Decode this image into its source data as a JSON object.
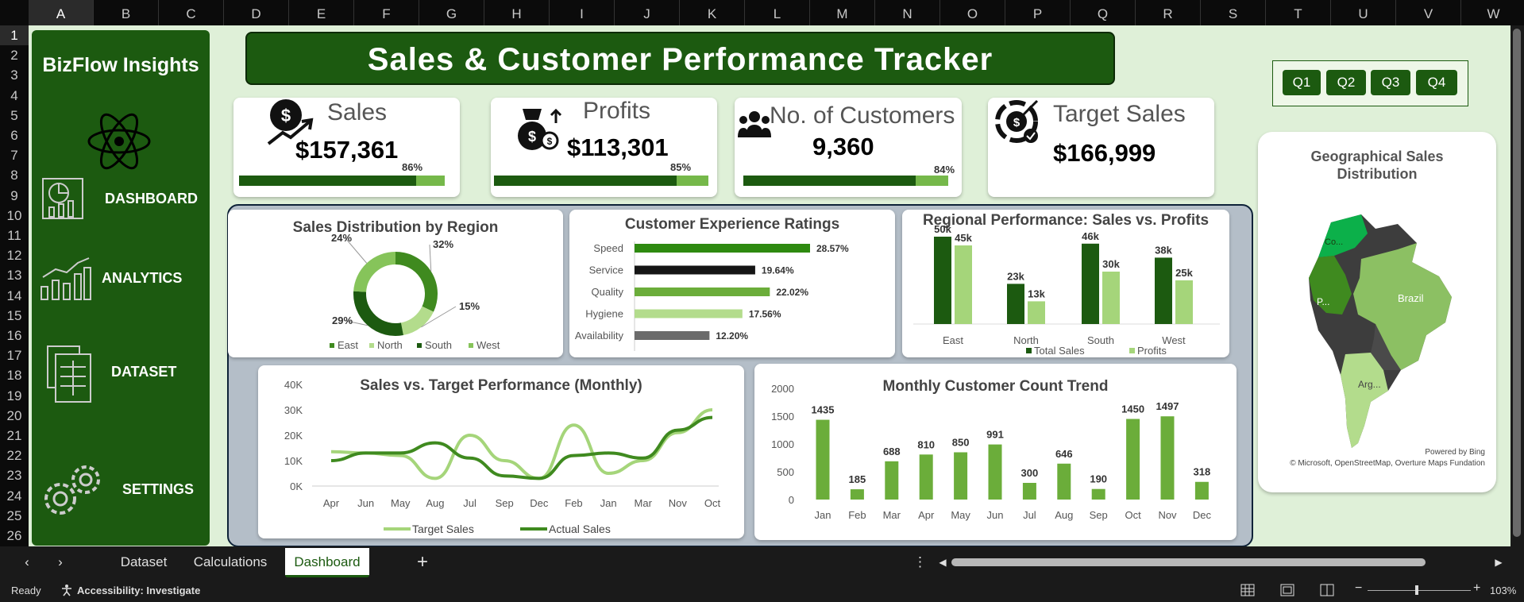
{
  "columns": [
    "A",
    "B",
    "C",
    "D",
    "E",
    "F",
    "G",
    "H",
    "I",
    "J",
    "K",
    "L",
    "M",
    "N",
    "O",
    "P",
    "Q",
    "R",
    "S",
    "T",
    "U",
    "V",
    "W"
  ],
  "rows": [
    "1",
    "2",
    "3",
    "4",
    "5",
    "6",
    "7",
    "8",
    "9",
    "10",
    "11",
    "12",
    "13",
    "14",
    "15",
    "16",
    "17",
    "18",
    "19",
    "20",
    "21",
    "22",
    "23",
    "24",
    "25",
    "26"
  ],
  "sidebar": {
    "brand": "BizFlow Insights",
    "items": [
      {
        "label": "DASHBOARD",
        "icon": "dashboard-chart-icon"
      },
      {
        "label": "ANALYTICS",
        "icon": "analytics-bars-icon"
      },
      {
        "label": "DATASET",
        "icon": "dataset-sheets-icon"
      },
      {
        "label": "SETTINGS",
        "icon": "settings-gears-icon"
      }
    ]
  },
  "title": "Sales & Customer Performance Tracker",
  "kpis": [
    {
      "label": "Sales",
      "value": "$157,361",
      "pct_label": "86%",
      "progress": 0.86,
      "icon": "dollar-growth-icon"
    },
    {
      "label": "Profits",
      "value": "$113,301",
      "pct_label": "85%",
      "progress": 0.85,
      "icon": "money-bag-icon"
    },
    {
      "label": "No. of Customers",
      "value": "9,360",
      "pct_label": "84%",
      "progress": 0.84,
      "icon": "customers-icon"
    },
    {
      "label": "Target Sales",
      "value": "$166,999",
      "icon": "target-dollar-icon"
    }
  ],
  "quarters": [
    "Q1",
    "Q2",
    "Q3",
    "Q4"
  ],
  "map": {
    "title": "Geographical Sales Distribution",
    "labels": [
      "Co...",
      "Brazil",
      "P...",
      "Arg..."
    ],
    "powered": "Powered by Bing",
    "credits": "© Microsoft, OpenStreetMap, Overture Maps Fundation"
  },
  "charts": {
    "donut": {
      "title": "Sales Distribution by Region"
    },
    "ratings": {
      "title": "Customer Experience Ratings"
    },
    "regional": {
      "title": "Regional Performance: Sales vs. Profits"
    },
    "target": {
      "title": "Sales vs. Target Performance (Monthly)"
    },
    "customers": {
      "title": "Monthly Customer Count Trend"
    }
  },
  "chart_data": [
    {
      "type": "pie",
      "title": "Sales Distribution by Region",
      "categories": [
        "East",
        "North",
        "South",
        "West"
      ],
      "values": [
        32,
        15,
        29,
        24
      ],
      "labels": [
        "32%",
        "15%",
        "29%",
        "24%"
      ],
      "colors": [
        "#3f8a1f",
        "#b3dc8c",
        "#1c5a10",
        "#86c45a"
      ],
      "legend": "bottom"
    },
    {
      "type": "bar",
      "title": "Customer Experience Ratings",
      "categories": [
        "Speed",
        "Service",
        "Quality",
        "Hygiene",
        "Availability"
      ],
      "values": [
        28.57,
        19.64,
        22.02,
        17.56,
        12.2
      ],
      "labels": [
        "28.57%",
        "19.64%",
        "22.02%",
        "17.56%",
        "12.20%"
      ],
      "colors": [
        "#2e8a10",
        "#151515",
        "#6bad3a",
        "#b3dc8c",
        "#6b6b6b"
      ]
    },
    {
      "type": "bar",
      "title": "Regional Performance: Sales vs. Profits",
      "categories": [
        "East",
        "North",
        "South",
        "West"
      ],
      "series": [
        {
          "name": "Total Sales",
          "values": [
            50,
            23,
            46,
            38
          ],
          "labels": [
            "50k",
            "23k",
            "46k",
            "38k"
          ],
          "color": "#1c5a10"
        },
        {
          "name": "Profits",
          "values": [
            45,
            13,
            30,
            25
          ],
          "labels": [
            "45k",
            "13k",
            "30k",
            "25k"
          ],
          "color": "#a5d57a"
        }
      ],
      "legend": "bottom"
    },
    {
      "type": "line",
      "title": "Sales vs. Target Performance (Monthly)",
      "x": [
        "Apr",
        "Jun",
        "May",
        "Aug",
        "Jul",
        "Sep",
        "Dec",
        "Feb",
        "Jan",
        "Mar",
        "Nov",
        "Oct"
      ],
      "yticks": [
        "0K",
        "10K",
        "20K",
        "30K",
        "40K"
      ],
      "ylim": [
        0,
        40
      ],
      "series": [
        {
          "name": "Target Sales",
          "values": [
            13.5,
            13,
            12,
            3,
            20,
            10,
            3,
            24,
            5,
            10,
            21,
            30
          ],
          "color": "#a5d57a"
        },
        {
          "name": "Actual Sales",
          "values": [
            10,
            13,
            13,
            17,
            11,
            4,
            3,
            12,
            13,
            11,
            22,
            27
          ],
          "color": "#3f8a1f"
        }
      ],
      "legend": "bottom"
    },
    {
      "type": "bar",
      "title": "Monthly Customer Count Trend",
      "categories": [
        "Jan",
        "Feb",
        "Mar",
        "Apr",
        "May",
        "Jun",
        "Jul",
        "Aug",
        "Sep",
        "Oct",
        "Nov",
        "Dec"
      ],
      "values": [
        1435,
        185,
        688,
        810,
        850,
        991,
        300,
        646,
        190,
        1450,
        1497,
        318
      ],
      "yticks": [
        "0",
        "500",
        "1000",
        "1500",
        "2000"
      ],
      "ylim": [
        0,
        2000
      ],
      "color": "#6bad3a"
    }
  ],
  "tabs": [
    "Dataset",
    "Calculations",
    "Dashboard"
  ],
  "status": {
    "ready": "Ready",
    "accessibility": "Accessibility: Investigate",
    "zoom": "103%"
  }
}
